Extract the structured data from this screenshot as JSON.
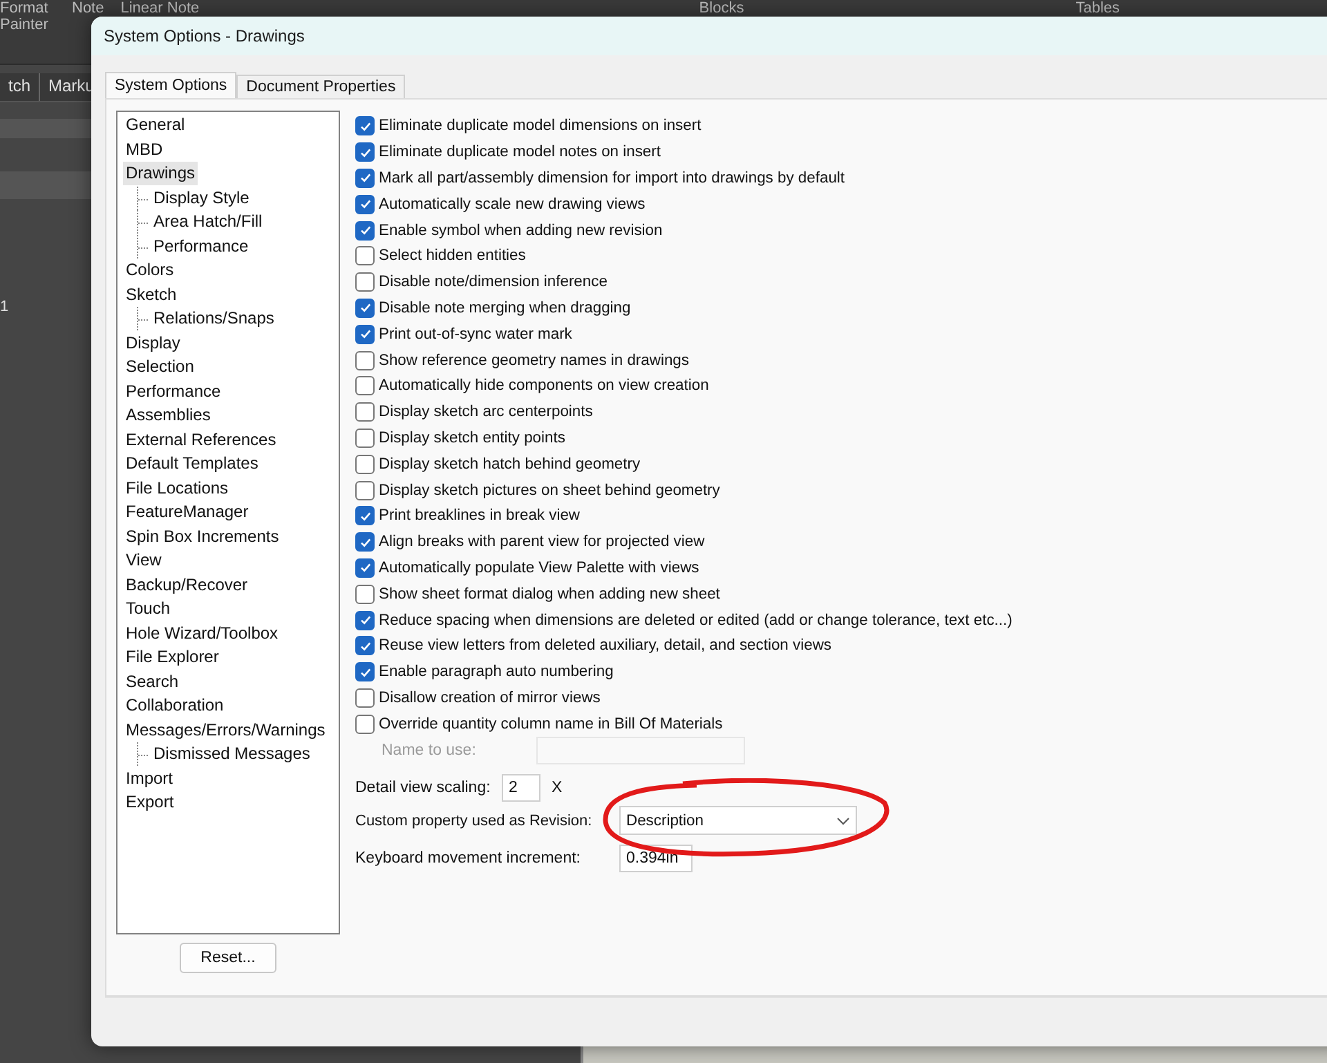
{
  "background_app": {
    "ribbon": [
      {
        "label": "Format Painter"
      },
      {
        "label": "Note"
      },
      {
        "label": "Linear Note"
      }
    ],
    "ribbon_right": [
      {
        "label": "Blocks"
      },
      {
        "label": "Tables"
      }
    ],
    "tabs": [
      {
        "label": "tch",
        "selected": false
      },
      {
        "label": "Marku",
        "selected": false
      }
    ],
    "side_text": "1"
  },
  "window": {
    "title": "System Options - Drawings"
  },
  "tabs": [
    {
      "label": "System Options",
      "selected": true
    },
    {
      "label": "Document Properties",
      "selected": false
    }
  ],
  "tree": [
    {
      "label": "General",
      "selected": false
    },
    {
      "label": "MBD",
      "selected": false
    },
    {
      "label": "Drawings",
      "selected": true,
      "children": [
        {
          "label": "Display Style",
          "selected": false
        },
        {
          "label": "Area Hatch/Fill",
          "selected": false
        },
        {
          "label": "Performance",
          "selected": false
        }
      ]
    },
    {
      "label": "Colors",
      "selected": false
    },
    {
      "label": "Sketch",
      "selected": false,
      "children": [
        {
          "label": "Relations/Snaps",
          "selected": false
        }
      ]
    },
    {
      "label": "Display",
      "selected": false
    },
    {
      "label": "Selection",
      "selected": false
    },
    {
      "label": "Performance",
      "selected": false
    },
    {
      "label": "Assemblies",
      "selected": false
    },
    {
      "label": "External References",
      "selected": false
    },
    {
      "label": "Default Templates",
      "selected": false
    },
    {
      "label": "File Locations",
      "selected": false
    },
    {
      "label": "FeatureManager",
      "selected": false
    },
    {
      "label": "Spin Box Increments",
      "selected": false
    },
    {
      "label": "View",
      "selected": false
    },
    {
      "label": "Backup/Recover",
      "selected": false
    },
    {
      "label": "Touch",
      "selected": false
    },
    {
      "label": "Hole Wizard/Toolbox",
      "selected": false
    },
    {
      "label": "File Explorer",
      "selected": false
    },
    {
      "label": "Search",
      "selected": false
    },
    {
      "label": "Collaboration",
      "selected": false
    },
    {
      "label": "Messages/Errors/Warnings",
      "selected": false,
      "children": [
        {
          "label": "Dismissed Messages",
          "selected": false
        }
      ]
    },
    {
      "label": "Import",
      "selected": false
    },
    {
      "label": "Export",
      "selected": false
    }
  ],
  "reset_button": "Reset...",
  "options": [
    {
      "label": "Eliminate duplicate model dimensions on insert",
      "checked": true
    },
    {
      "label": "Eliminate duplicate model notes on insert",
      "checked": true
    },
    {
      "label": "Mark all part/assembly dimension for import into drawings by default",
      "checked": true
    },
    {
      "label": "Automatically scale new drawing views",
      "checked": true
    },
    {
      "label": "Enable symbol when adding new revision",
      "checked": true
    },
    {
      "label": "Select hidden entities",
      "checked": false
    },
    {
      "label": "Disable note/dimension inference",
      "checked": false
    },
    {
      "label": "Disable note merging when dragging",
      "checked": true
    },
    {
      "label": "Print out-of-sync water mark",
      "checked": true
    },
    {
      "label": "Show reference geometry names in drawings",
      "checked": false
    },
    {
      "label": "Automatically hide components on view creation",
      "checked": false
    },
    {
      "label": "Display sketch arc centerpoints",
      "checked": false
    },
    {
      "label": "Display sketch entity points",
      "checked": false
    },
    {
      "label": "Display sketch hatch behind geometry",
      "checked": false
    },
    {
      "label": "Display sketch pictures on sheet behind geometry",
      "checked": false
    },
    {
      "label": "Print breaklines in break view",
      "checked": true
    },
    {
      "label": "Align breaks with parent view for projected view",
      "checked": true
    },
    {
      "label": "Automatically populate View Palette with views",
      "checked": true
    },
    {
      "label": "Show sheet format dialog when adding new sheet",
      "checked": false
    },
    {
      "label": "Reduce spacing when dimensions are deleted or edited (add or change tolerance, text etc...)",
      "checked": true
    },
    {
      "label": "Reuse view letters from deleted auxiliary, detail, and section views",
      "checked": true
    },
    {
      "label": "Enable paragraph auto numbering",
      "checked": true
    },
    {
      "label": "Disallow creation of mirror views",
      "checked": false
    },
    {
      "label": "Override quantity column name in Bill Of Materials",
      "checked": false
    }
  ],
  "name_to_use": {
    "label": "Name to use:",
    "disabled": true
  },
  "detail_view_scaling": {
    "label": "Detail view scaling:",
    "value": "2",
    "unit": "X"
  },
  "revision_property": {
    "label": "Custom property used as Revision:",
    "value": "Description"
  },
  "keyboard_increment": {
    "label": "Keyboard movement increment:",
    "value": "0.394in"
  }
}
